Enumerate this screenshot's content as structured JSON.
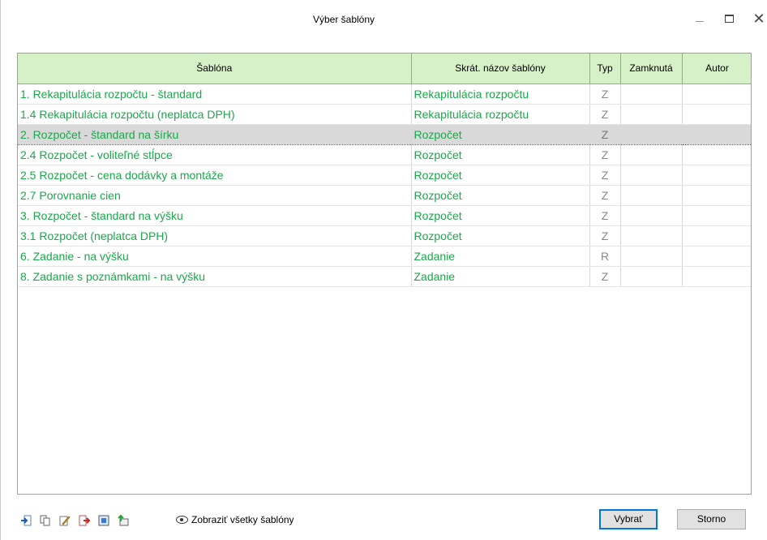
{
  "window": {
    "title": "Výber šablóny",
    "controls": {
      "minimize": "—",
      "maximize": "☐",
      "close": "✕"
    }
  },
  "table": {
    "columns": [
      "Šablóna",
      "Skrát. názov šablóny",
      "Typ",
      "Zamknutá",
      "Autor"
    ],
    "rows": [
      {
        "name": "1. Rekapitulácia rozpočtu - štandard",
        "short": "Rekapitulácia rozpočtu",
        "type": "Z",
        "locked": "",
        "author": ""
      },
      {
        "name": "1.4 Rekapitulácia rozpočtu (neplatca DPH)",
        "short": "Rekapitulácia rozpočtu",
        "type": "Z",
        "locked": "",
        "author": ""
      },
      {
        "name": "2. Rozpočet - štandard na šírku",
        "short": "Rozpočet",
        "type": "Z",
        "locked": "",
        "author": ""
      },
      {
        "name": "2.4 Rozpočet - voliteľné stĺpce",
        "short": "Rozpočet",
        "type": "Z",
        "locked": "",
        "author": ""
      },
      {
        "name": "2.5 Rozpočet - cena dodávky a montáže",
        "short": "Rozpočet",
        "type": "Z",
        "locked": "",
        "author": ""
      },
      {
        "name": "2.7 Porovnanie cien",
        "short": "Rozpočet",
        "type": "Z",
        "locked": "",
        "author": ""
      },
      {
        "name": "3. Rozpočet - štandard na výšku",
        "short": "Rozpočet",
        "type": "Z",
        "locked": "",
        "author": ""
      },
      {
        "name": "3.1 Rozpočet (neplatca DPH)",
        "short": "Rozpočet",
        "type": "Z",
        "locked": "",
        "author": ""
      },
      {
        "name": "6. Zadanie - na výšku",
        "short": "Zadanie",
        "type": "R",
        "locked": "",
        "author": ""
      },
      {
        "name": "8. Zadanie s poznámkami - na výšku",
        "short": "Zadanie",
        "type": "Z",
        "locked": "",
        "author": ""
      }
    ],
    "selected_index": 2
  },
  "toolbar": {
    "icons": [
      "import-icon",
      "copy-icon",
      "edit-icon",
      "export-icon",
      "preview-icon",
      "upload-icon"
    ],
    "show_all_label": "Zobraziť všetky šablóny",
    "show_all_icon": "eye-icon"
  },
  "buttons": {
    "select": "Vybrať",
    "cancel": "Storno"
  },
  "colors": {
    "header_bg": "#d6f0c8",
    "row_text": "#1aa84a",
    "selected_row_bg": "#d9d9d9",
    "primary_button_border": "#0078d7"
  }
}
